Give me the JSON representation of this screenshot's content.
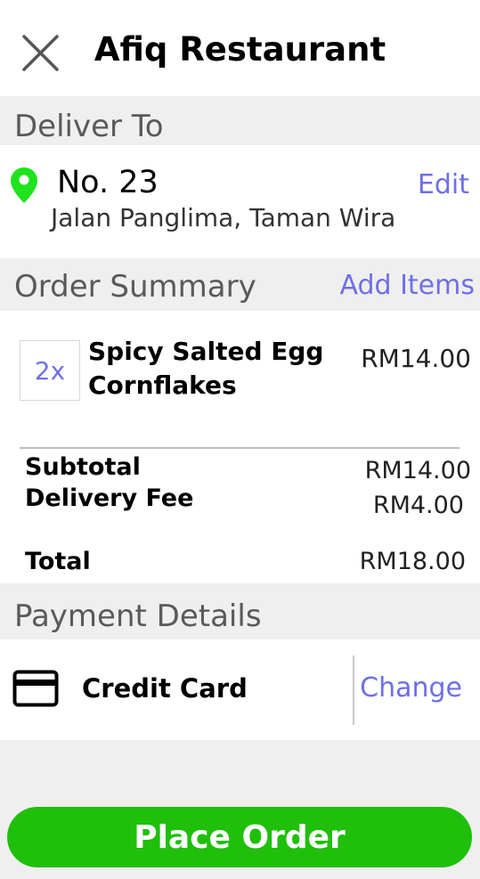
{
  "header": {
    "title": "Afiq Restaurant",
    "close_icon": "close-icon"
  },
  "deliver": {
    "section_title": "Deliver To",
    "address_line1": "No. 23",
    "address_line2": "Jalan Panglima, Taman Wira",
    "edit_label": "Edit",
    "pin_icon": "location-pin-icon",
    "pin_color": "#1fe31f"
  },
  "order": {
    "section_title": "Order Summary",
    "add_items_label": "Add Items",
    "items": [
      {
        "quantity": "2x",
        "name": "Spicy Salted Egg Cornflakes",
        "price": "RM14.00"
      }
    ],
    "subtotal_label": "Subtotal",
    "subtotal_value": "RM14.00",
    "delivery_fee_label": "Delivery Fee",
    "delivery_fee_value": "RM4.00",
    "total_label": "Total",
    "total_value": "RM18.00"
  },
  "payment": {
    "section_title": "Payment Details",
    "method": "Credit Card",
    "method_icon": "credit-card-icon",
    "change_label": "Change"
  },
  "actions": {
    "place_order_label": "Place Order",
    "place_order_color": "#1fbf0c"
  },
  "colors": {
    "link": "#6f6fe6",
    "background": "#efefef"
  }
}
